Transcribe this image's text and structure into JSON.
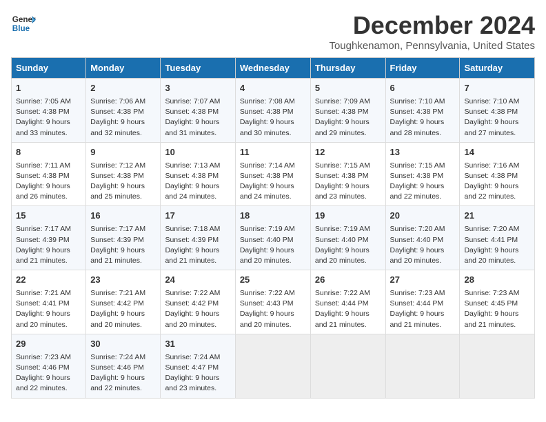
{
  "logo": {
    "line1": "General",
    "line2": "Blue"
  },
  "title": "December 2024",
  "subtitle": "Toughkenamon, Pennsylvania, United States",
  "days_of_week": [
    "Sunday",
    "Monday",
    "Tuesday",
    "Wednesday",
    "Thursday",
    "Friday",
    "Saturday"
  ],
  "weeks": [
    [
      {
        "day": "1",
        "sunrise": "Sunrise: 7:05 AM",
        "sunset": "Sunset: 4:38 PM",
        "daylight": "Daylight: 9 hours and 33 minutes."
      },
      {
        "day": "2",
        "sunrise": "Sunrise: 7:06 AM",
        "sunset": "Sunset: 4:38 PM",
        "daylight": "Daylight: 9 hours and 32 minutes."
      },
      {
        "day": "3",
        "sunrise": "Sunrise: 7:07 AM",
        "sunset": "Sunset: 4:38 PM",
        "daylight": "Daylight: 9 hours and 31 minutes."
      },
      {
        "day": "4",
        "sunrise": "Sunrise: 7:08 AM",
        "sunset": "Sunset: 4:38 PM",
        "daylight": "Daylight: 9 hours and 30 minutes."
      },
      {
        "day": "5",
        "sunrise": "Sunrise: 7:09 AM",
        "sunset": "Sunset: 4:38 PM",
        "daylight": "Daylight: 9 hours and 29 minutes."
      },
      {
        "day": "6",
        "sunrise": "Sunrise: 7:10 AM",
        "sunset": "Sunset: 4:38 PM",
        "daylight": "Daylight: 9 hours and 28 minutes."
      },
      {
        "day": "7",
        "sunrise": "Sunrise: 7:10 AM",
        "sunset": "Sunset: 4:38 PM",
        "daylight": "Daylight: 9 hours and 27 minutes."
      }
    ],
    [
      {
        "day": "8",
        "sunrise": "Sunrise: 7:11 AM",
        "sunset": "Sunset: 4:38 PM",
        "daylight": "Daylight: 9 hours and 26 minutes."
      },
      {
        "day": "9",
        "sunrise": "Sunrise: 7:12 AM",
        "sunset": "Sunset: 4:38 PM",
        "daylight": "Daylight: 9 hours and 25 minutes."
      },
      {
        "day": "10",
        "sunrise": "Sunrise: 7:13 AM",
        "sunset": "Sunset: 4:38 PM",
        "daylight": "Daylight: 9 hours and 24 minutes."
      },
      {
        "day": "11",
        "sunrise": "Sunrise: 7:14 AM",
        "sunset": "Sunset: 4:38 PM",
        "daylight": "Daylight: 9 hours and 24 minutes."
      },
      {
        "day": "12",
        "sunrise": "Sunrise: 7:15 AM",
        "sunset": "Sunset: 4:38 PM",
        "daylight": "Daylight: 9 hours and 23 minutes."
      },
      {
        "day": "13",
        "sunrise": "Sunrise: 7:15 AM",
        "sunset": "Sunset: 4:38 PM",
        "daylight": "Daylight: 9 hours and 22 minutes."
      },
      {
        "day": "14",
        "sunrise": "Sunrise: 7:16 AM",
        "sunset": "Sunset: 4:38 PM",
        "daylight": "Daylight: 9 hours and 22 minutes."
      }
    ],
    [
      {
        "day": "15",
        "sunrise": "Sunrise: 7:17 AM",
        "sunset": "Sunset: 4:39 PM",
        "daylight": "Daylight: 9 hours and 21 minutes."
      },
      {
        "day": "16",
        "sunrise": "Sunrise: 7:17 AM",
        "sunset": "Sunset: 4:39 PM",
        "daylight": "Daylight: 9 hours and 21 minutes."
      },
      {
        "day": "17",
        "sunrise": "Sunrise: 7:18 AM",
        "sunset": "Sunset: 4:39 PM",
        "daylight": "Daylight: 9 hours and 21 minutes."
      },
      {
        "day": "18",
        "sunrise": "Sunrise: 7:19 AM",
        "sunset": "Sunset: 4:40 PM",
        "daylight": "Daylight: 9 hours and 20 minutes."
      },
      {
        "day": "19",
        "sunrise": "Sunrise: 7:19 AM",
        "sunset": "Sunset: 4:40 PM",
        "daylight": "Daylight: 9 hours and 20 minutes."
      },
      {
        "day": "20",
        "sunrise": "Sunrise: 7:20 AM",
        "sunset": "Sunset: 4:40 PM",
        "daylight": "Daylight: 9 hours and 20 minutes."
      },
      {
        "day": "21",
        "sunrise": "Sunrise: 7:20 AM",
        "sunset": "Sunset: 4:41 PM",
        "daylight": "Daylight: 9 hours and 20 minutes."
      }
    ],
    [
      {
        "day": "22",
        "sunrise": "Sunrise: 7:21 AM",
        "sunset": "Sunset: 4:41 PM",
        "daylight": "Daylight: 9 hours and 20 minutes."
      },
      {
        "day": "23",
        "sunrise": "Sunrise: 7:21 AM",
        "sunset": "Sunset: 4:42 PM",
        "daylight": "Daylight: 9 hours and 20 minutes."
      },
      {
        "day": "24",
        "sunrise": "Sunrise: 7:22 AM",
        "sunset": "Sunset: 4:42 PM",
        "daylight": "Daylight: 9 hours and 20 minutes."
      },
      {
        "day": "25",
        "sunrise": "Sunrise: 7:22 AM",
        "sunset": "Sunset: 4:43 PM",
        "daylight": "Daylight: 9 hours and 20 minutes."
      },
      {
        "day": "26",
        "sunrise": "Sunrise: 7:22 AM",
        "sunset": "Sunset: 4:44 PM",
        "daylight": "Daylight: 9 hours and 21 minutes."
      },
      {
        "day": "27",
        "sunrise": "Sunrise: 7:23 AM",
        "sunset": "Sunset: 4:44 PM",
        "daylight": "Daylight: 9 hours and 21 minutes."
      },
      {
        "day": "28",
        "sunrise": "Sunrise: 7:23 AM",
        "sunset": "Sunset: 4:45 PM",
        "daylight": "Daylight: 9 hours and 21 minutes."
      }
    ],
    [
      {
        "day": "29",
        "sunrise": "Sunrise: 7:23 AM",
        "sunset": "Sunset: 4:46 PM",
        "daylight": "Daylight: 9 hours and 22 minutes."
      },
      {
        "day": "30",
        "sunrise": "Sunrise: 7:24 AM",
        "sunset": "Sunset: 4:46 PM",
        "daylight": "Daylight: 9 hours and 22 minutes."
      },
      {
        "day": "31",
        "sunrise": "Sunrise: 7:24 AM",
        "sunset": "Sunset: 4:47 PM",
        "daylight": "Daylight: 9 hours and 23 minutes."
      },
      null,
      null,
      null,
      null
    ]
  ]
}
